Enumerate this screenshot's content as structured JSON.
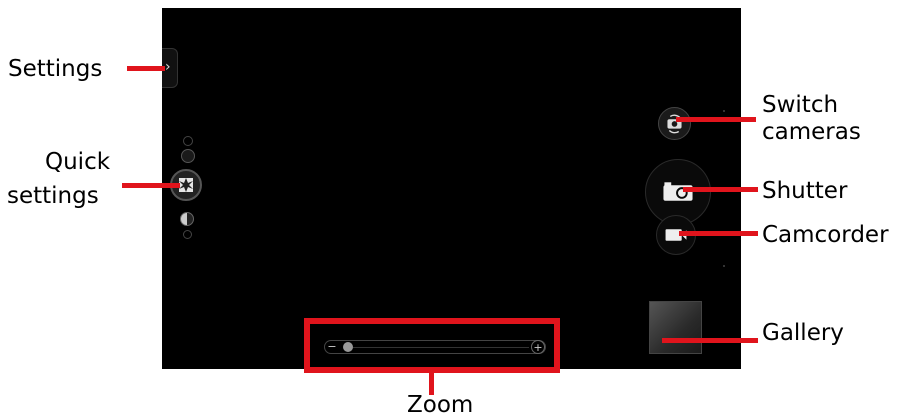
{
  "callouts": {
    "settings": "Settings",
    "quick_settings_1": "Quick",
    "quick_settings_2": "settings",
    "switch_cameras_1": "Switch",
    "switch_cameras_2": "cameras",
    "shutter": "Shutter",
    "camcorder": "Camcorder",
    "gallery": "Gallery",
    "zoom": "Zoom"
  },
  "controls": {
    "settings_chevron": "›",
    "zoom_minus": "−",
    "zoom_plus": "+"
  },
  "icons": {
    "settings": "chevron-right-icon",
    "quick_settings": "aperture-icon",
    "switch_cameras": "camera-switch-icon",
    "shutter": "camera-icon",
    "camcorder": "video-camera-icon",
    "gallery": "gallery-thumbnail"
  },
  "colors": {
    "callout": "#e0141c",
    "screen": "#000000"
  }
}
